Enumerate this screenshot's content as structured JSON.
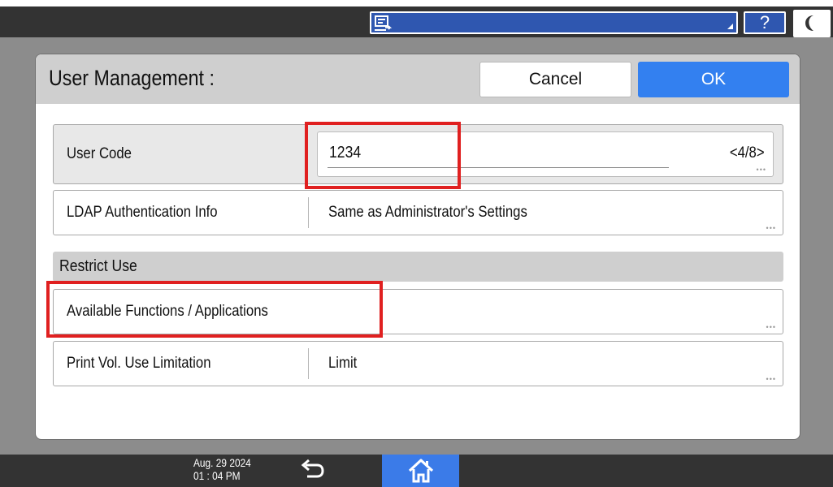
{
  "topbar": {
    "help_label": "?",
    "job_icon": "job-list-icon",
    "sleep_icon": "moon-icon"
  },
  "dialog": {
    "title": "User Management :",
    "cancel_label": "Cancel",
    "ok_label": "OK"
  },
  "fields": {
    "user_code": {
      "label": "User Code",
      "value": "1234",
      "counter": "<4/8>"
    },
    "ldap": {
      "label": "LDAP Authentication Info",
      "value": "Same as Administrator's Settings"
    },
    "restrict_header": "Restrict Use",
    "functions": {
      "label": "Available Functions / Applications"
    },
    "print_vol": {
      "label": "Print Vol. Use Limitation",
      "value": "Limit"
    }
  },
  "statusbar": {
    "date": "Aug. 29 2024",
    "time": "01 : 04 PM",
    "back_icon": "back-arrow-icon",
    "home_icon": "home-icon"
  },
  "colors": {
    "accent_blue": "#3380f0",
    "bar_dark": "#333333",
    "highlight_red": "#e02020"
  }
}
